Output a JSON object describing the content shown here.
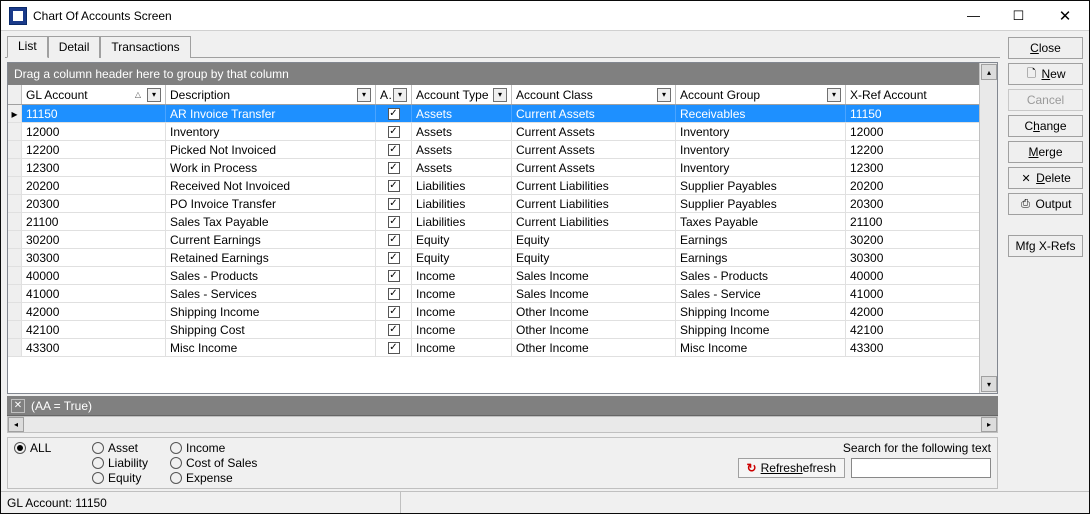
{
  "window": {
    "title": "Chart Of Accounts Screen"
  },
  "tabs": [
    {
      "label": "List",
      "active": true
    },
    {
      "label": "Detail",
      "active": false
    },
    {
      "label": "Transactions",
      "active": false
    }
  ],
  "group_hint": "Drag a column header here to group by that column",
  "columns": {
    "gl": {
      "label": "GL Account"
    },
    "desc": {
      "label": "Description"
    },
    "aa": {
      "label": "AA"
    },
    "atype": {
      "label": "Account Type"
    },
    "aclass": {
      "label": "Account Class"
    },
    "agroup": {
      "label": "Account Group"
    },
    "xref": {
      "label": "X-Ref Account"
    }
  },
  "rows": [
    {
      "gl": "11150",
      "desc": "AR Invoice Transfer",
      "aa": true,
      "atype": "Assets",
      "aclass": "Current Assets",
      "agroup": "Receivables",
      "xref": "11150",
      "selected": true
    },
    {
      "gl": "12000",
      "desc": "Inventory",
      "aa": true,
      "atype": "Assets",
      "aclass": "Current Assets",
      "agroup": "Inventory",
      "xref": "12000"
    },
    {
      "gl": "12200",
      "desc": "Picked Not Invoiced",
      "aa": true,
      "atype": "Assets",
      "aclass": "Current Assets",
      "agroup": "Inventory",
      "xref": "12200"
    },
    {
      "gl": "12300",
      "desc": "Work in Process",
      "aa": true,
      "atype": "Assets",
      "aclass": "Current Assets",
      "agroup": "Inventory",
      "xref": "12300"
    },
    {
      "gl": "20200",
      "desc": "Received Not Invoiced",
      "aa": true,
      "atype": "Liabilities",
      "aclass": "Current Liabilities",
      "agroup": "Supplier Payables",
      "xref": "20200"
    },
    {
      "gl": "20300",
      "desc": "PO Invoice Transfer",
      "aa": true,
      "atype": "Liabilities",
      "aclass": "Current Liabilities",
      "agroup": "Supplier Payables",
      "xref": "20300"
    },
    {
      "gl": "21100",
      "desc": "Sales Tax Payable",
      "aa": true,
      "atype": "Liabilities",
      "aclass": "Current Liabilities",
      "agroup": "Taxes Payable",
      "xref": "21100"
    },
    {
      "gl": "30200",
      "desc": "Current Earnings",
      "aa": true,
      "atype": "Equity",
      "aclass": "Equity",
      "agroup": "Earnings",
      "xref": "30200"
    },
    {
      "gl": "30300",
      "desc": "Retained Earnings",
      "aa": true,
      "atype": "Equity",
      "aclass": "Equity",
      "agroup": "Earnings",
      "xref": "30300"
    },
    {
      "gl": "40000",
      "desc": "Sales - Products",
      "aa": true,
      "atype": "Income",
      "aclass": "Sales Income",
      "agroup": "Sales - Products",
      "xref": "40000"
    },
    {
      "gl": "41000",
      "desc": "Sales - Services",
      "aa": true,
      "atype": "Income",
      "aclass": "Sales Income",
      "agroup": "Sales - Service",
      "xref": "41000"
    },
    {
      "gl": "42000",
      "desc": "Shipping Income",
      "aa": true,
      "atype": "Income",
      "aclass": "Other Income",
      "agroup": "Shipping Income",
      "xref": "42000"
    },
    {
      "gl": "42100",
      "desc": "Shipping Cost",
      "aa": true,
      "atype": "Income",
      "aclass": "Other Income",
      "agroup": "Shipping Income",
      "xref": "42100"
    },
    {
      "gl": "43300",
      "desc": "Misc Income",
      "aa": true,
      "atype": "Income",
      "aclass": "Other Income",
      "agroup": "Misc Income",
      "xref": "43300"
    }
  ],
  "filter_row": {
    "text": "(AA = True)"
  },
  "type_filters": {
    "all": "ALL",
    "asset": "Asset",
    "liability": "Liability",
    "equity": "Equity",
    "income": "Income",
    "cost": "Cost of Sales",
    "expense": "Expense",
    "selected": "all"
  },
  "search": {
    "hint": "Search for the following text",
    "refresh": "Refresh",
    "value": ""
  },
  "buttons": {
    "close": "Close",
    "new": "New",
    "cancel": "Cancel",
    "change": "Change",
    "merge": "Merge",
    "delete": "Delete",
    "output": "Output",
    "mfg": "Mfg X-Refs"
  },
  "status": {
    "text": "GL Account: 11150"
  }
}
